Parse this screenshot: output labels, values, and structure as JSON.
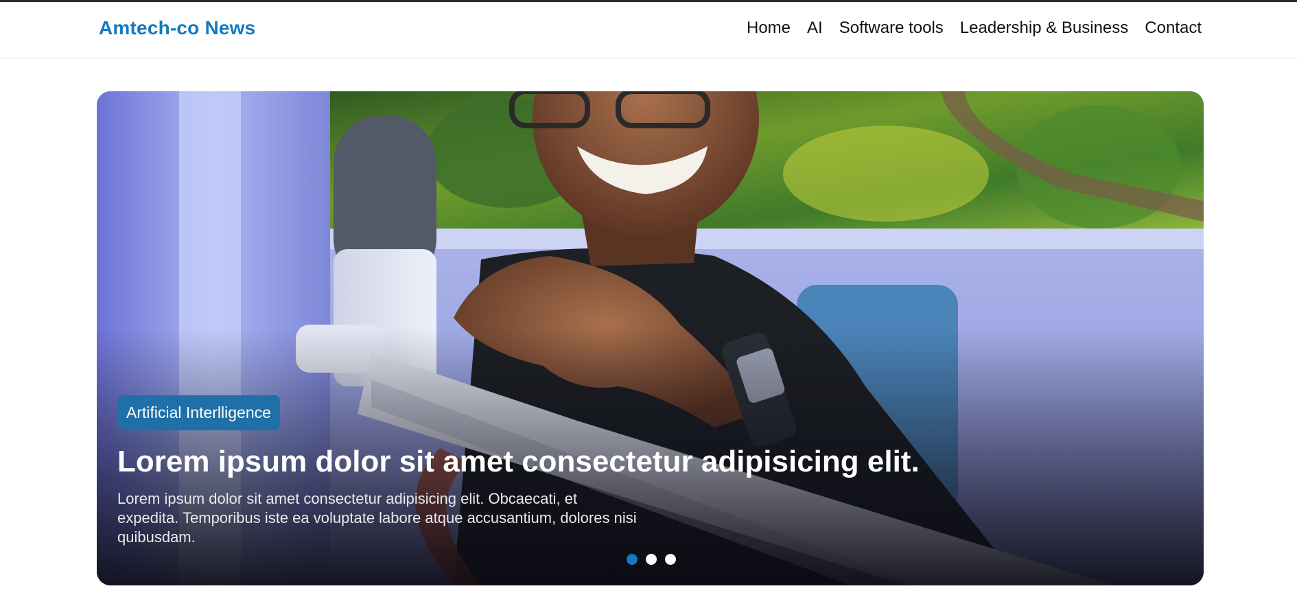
{
  "site": {
    "brand": "Amtech-co News"
  },
  "nav": {
    "items": [
      {
        "label": "Home"
      },
      {
        "label": "AI"
      },
      {
        "label": "Software tools"
      },
      {
        "label": "Leadership & Business"
      },
      {
        "label": "Contact"
      }
    ]
  },
  "hero": {
    "category": "Artificial Interlligence",
    "title": "Lorem ipsum dolor sit amet consectetur adipisicing elit.",
    "description": "Lorem ipsum dolor sit amet consectetur adipisicing elit. Obcaecati, et expedita. Temporibus iste ea voluptate labore atque accusantium, dolores nisi quibusdam.",
    "slides": {
      "count": 3,
      "active": 1
    }
  },
  "colors": {
    "accent": "#1479c0",
    "badge": "#1f6fa9",
    "topline": "#2b2b2b"
  }
}
